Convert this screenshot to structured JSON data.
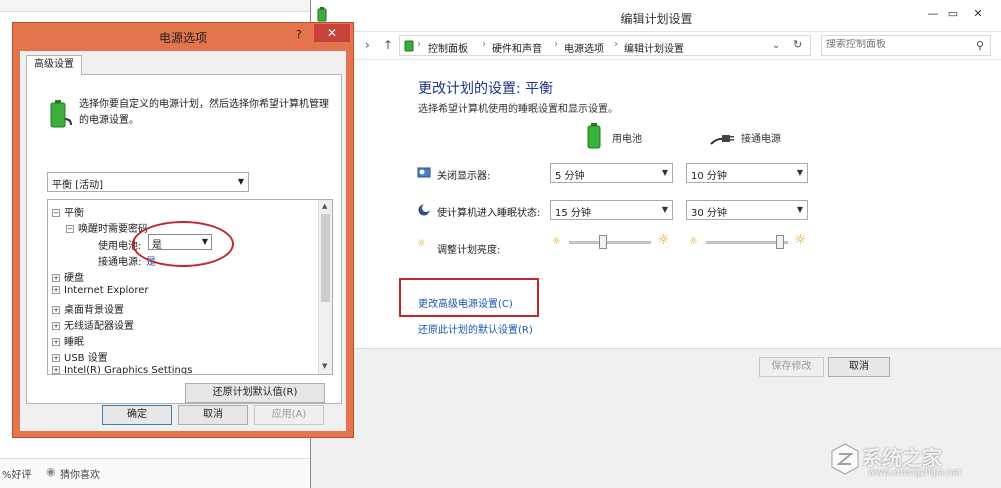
{
  "background_page": {
    "footer_left": "%好评",
    "footer_right": "猜你喜欢"
  },
  "control_panel": {
    "title": "编辑计划设置",
    "breadcrumbs": [
      "控制面板",
      "硬件和声音",
      "电源选项",
      "编辑计划设置"
    ],
    "search_placeholder": "搜索控制面板",
    "heading": "更改计划的设置: 平衡",
    "subheading": "选择希望计算机使用的睡眠设置和显示设置。",
    "col_battery": "用电池",
    "col_plugged": "接通电源",
    "rows": [
      {
        "label": "关闭显示器:",
        "battery": "5 分钟",
        "plugged": "10 分钟"
      },
      {
        "label": "使计算机进入睡眠状态:",
        "battery": "15 分钟",
        "plugged": "30 分钟"
      }
    ],
    "brightness_label": "调整计划亮度:",
    "brightness": {
      "battery": 0.4,
      "plugged": 0.95
    },
    "advanced_link": "更改高级电源设置(C)",
    "restore_link": "还原此计划的默认设置(R)",
    "save_button": "保存修改",
    "cancel_button": "取消"
  },
  "power_dialog": {
    "title": "电源选项",
    "help": "?",
    "close": "✕",
    "tab": "高级设置",
    "description": "选择你要自定义的电源计划，然后选择你希望计算机管理的电源设置。",
    "plan_selected": "平衡 [活动]",
    "tree": {
      "root": "平衡",
      "wake_timers": "唤醒时需要密码",
      "on_battery_label": "使用电池:",
      "on_battery_value": "是",
      "plugged_label": "接通电源:",
      "plugged_value": "是",
      "items": [
        "硬盘",
        "Internet Explorer",
        "桌面背景设置",
        "无线适配器设置",
        "睡眠",
        "USB 设置",
        "Intel(R) Graphics Settings"
      ]
    },
    "restore_button": "还原计划默认值(R)",
    "ok_button": "确定",
    "cancel_button": "取消",
    "apply_button": "应用(A)"
  },
  "watermark": {
    "text": "系统之家",
    "url": "www.xitongzhijia.net"
  },
  "colors": {
    "dialog_frame": "#e4744d",
    "close_button": "#c7423a",
    "highlight": "#c0282c",
    "link": "#1a56b0",
    "heading": "#1e3287"
  }
}
